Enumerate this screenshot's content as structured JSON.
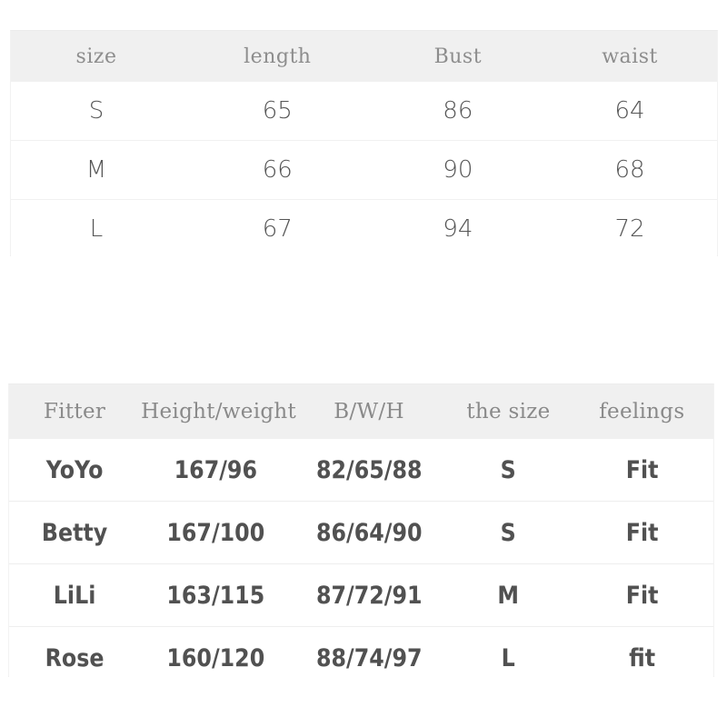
{
  "colors": {
    "page_background": "#ffffff",
    "header_background": "#f0f0f0",
    "header_text": "#8a8a8a",
    "body_text": "#515151",
    "row_divider": "#eeeeee"
  },
  "size_chart": {
    "headers": [
      "size",
      "length",
      "Bust",
      "waist"
    ],
    "rows": [
      [
        "S",
        "65",
        "86",
        "64"
      ],
      [
        "M",
        "66",
        "90",
        "68"
      ],
      [
        "L",
        "67",
        "94",
        "72"
      ]
    ]
  },
  "fitter_chart": {
    "headers": [
      "Fitter",
      "Height/weight",
      "B/W/H",
      "the size",
      "feelings"
    ],
    "rows": [
      [
        "YoYo",
        "167/96",
        "82/65/88",
        "S",
        "Fit"
      ],
      [
        "Betty",
        "167/100",
        "86/64/90",
        "S",
        "Fit"
      ],
      [
        "LiLi",
        "163/115",
        "87/72/91",
        "M",
        "Fit"
      ],
      [
        "Rose",
        "160/120",
        "88/74/97",
        "L",
        "fit"
      ]
    ]
  }
}
